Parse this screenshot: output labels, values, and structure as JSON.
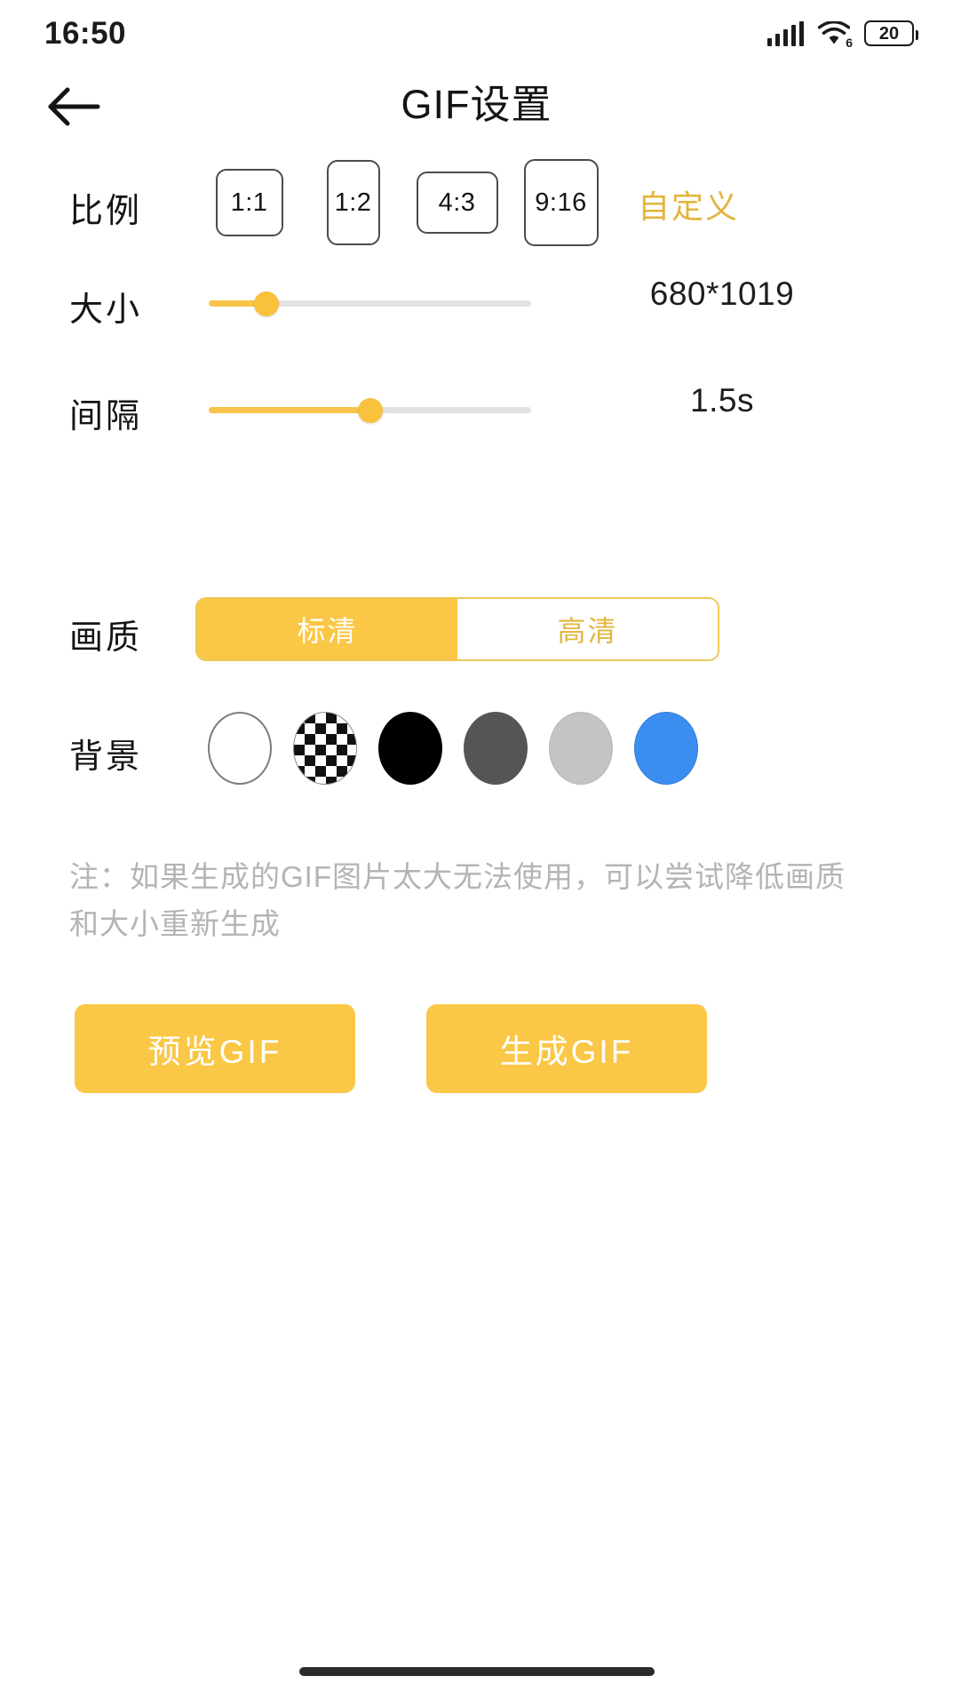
{
  "status_bar": {
    "time": "16:50",
    "signal_icon": "cellular-signal-icon",
    "wifi_icon": "wifi-icon",
    "wifi_generation": "6",
    "battery_level": "20",
    "battery_icon": "battery-icon"
  },
  "nav": {
    "back_icon": "back-arrow-icon",
    "title": "GIF设置"
  },
  "ratio": {
    "label": "比例",
    "options": [
      {
        "value": "1:1"
      },
      {
        "value": "1:2"
      },
      {
        "value": "4:3"
      },
      {
        "value": "9:16"
      }
    ],
    "custom_label": "自定义",
    "custom_color": "#e3b43c"
  },
  "size": {
    "label": "大小",
    "value": "680*1019",
    "slider_percent": 18
  },
  "interval": {
    "label": "间隔",
    "value": "1.5s",
    "slider_percent": 50
  },
  "quality": {
    "label": "画质",
    "options": [
      {
        "label": "标清",
        "selected": true
      },
      {
        "label": "高清",
        "selected": false
      }
    ],
    "accent_color": "#fac746"
  },
  "background": {
    "label": "背景",
    "swatches": [
      {
        "name": "white",
        "color": "#ffffff"
      },
      {
        "name": "transparent",
        "color": "transparent"
      },
      {
        "name": "black",
        "color": "#000000"
      },
      {
        "name": "dark-gray",
        "color": "#555555"
      },
      {
        "name": "light-gray",
        "color": "#c4c4c4"
      },
      {
        "name": "blue",
        "color": "#3b8ef0"
      }
    ]
  },
  "note": {
    "text": "注：如果生成的GIF图片太大无法使用，可以尝试降低画质和大小重新生成"
  },
  "actions": {
    "preview_label": "预览GIF",
    "generate_label": "生成GIF"
  }
}
